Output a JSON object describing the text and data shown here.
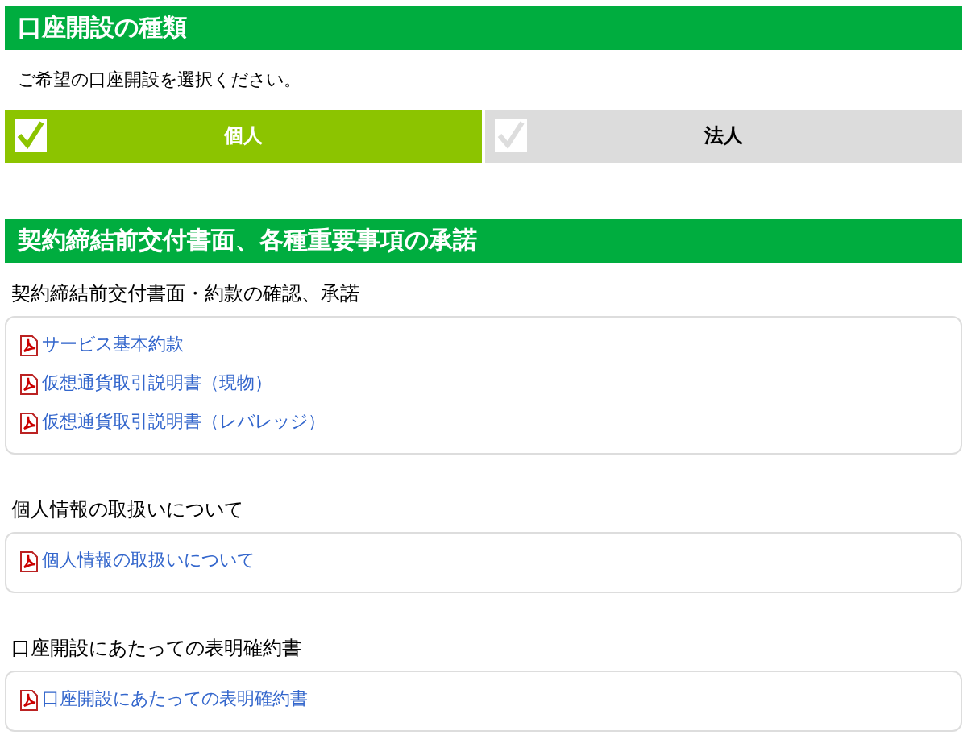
{
  "account_type": {
    "heading": "口座開設の種類",
    "instruction": "ご希望の口座開設を選択ください。",
    "options": [
      {
        "label": "個人",
        "selected": true
      },
      {
        "label": "法人",
        "selected": false
      }
    ]
  },
  "agreements": {
    "heading": "契約締結前交付書面、各種重要事項の承諾",
    "groups": [
      {
        "title": "契約締結前交付書面・約款の確認、承諾",
        "documents": [
          "サービス基本約款",
          "仮想通貨取引説明書（現物）",
          "仮想通貨取引説明書（レバレッジ）"
        ]
      },
      {
        "title": "個人情報の取扱いについて",
        "documents": [
          "個人情報の取扱いについて"
        ]
      },
      {
        "title": "口座開設にあたっての表明確約書",
        "documents": [
          "口座開設にあたっての表明確約書"
        ]
      }
    ]
  }
}
